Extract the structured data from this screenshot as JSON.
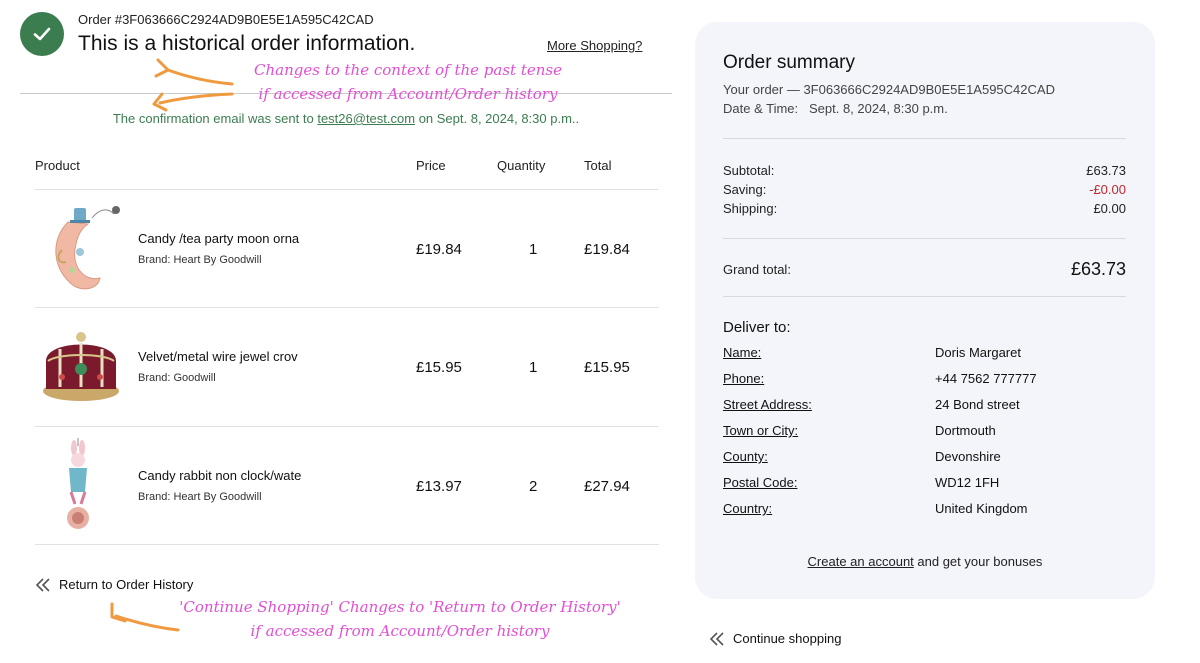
{
  "header": {
    "order_id_text": "Order #3F063666C2924AD9B0E5E1A595C42CAD",
    "title": "This is a historical order information.",
    "more_shopping": "More Shopping?",
    "confirmation_prefix": "The confirmation email was sent to ",
    "confirmation_email": "test26@test.com",
    "confirmation_suffix": " on Sept. 8, 2024, 8:30 p.m.."
  },
  "table": {
    "columns": [
      "Product",
      "Price",
      "Quantity",
      "Total"
    ],
    "rows": [
      {
        "name": "Candy /tea party moon orna",
        "brand_label": "Brand:",
        "brand": "Heart By Goodwill",
        "price": "£19.84",
        "quantity": "1",
        "total": "£19.84"
      },
      {
        "name": "Velvet/metal wire jewel crov",
        "brand_label": "Brand:",
        "brand": "Goodwill",
        "price": "£15.95",
        "quantity": "1",
        "total": "£15.95"
      },
      {
        "name": "Candy rabbit non clock/wate",
        "brand_label": "Brand:",
        "brand": "Heart By Goodwill",
        "price": "£13.97",
        "quantity": "2",
        "total": "£27.94"
      }
    ]
  },
  "return_link": "Return to Order History",
  "summary": {
    "title": "Order summary",
    "your_order": "Your order — 3F063666C2924AD9B0E5E1A595C42CAD",
    "date_time": "Date & Time:   Sept. 8, 2024, 8:30 p.m.",
    "subtotal_label": "Subtotal:",
    "subtotal_value": "£63.73",
    "saving_label": "Saving:",
    "saving_value": "-£0.00",
    "shipping_label": "Shipping:",
    "shipping_value": "£0.00",
    "grand_total_label": "Grand total:",
    "grand_total_value": "£63.73",
    "deliver_title": "Deliver to:",
    "deliver": [
      {
        "label": "Name:",
        "value": "Doris Margaret"
      },
      {
        "label": "Phone:",
        "value": "+44 7562 777777"
      },
      {
        "label": "Street Address:",
        "value": "24 Bond street"
      },
      {
        "label": "Town or City:",
        "value": "Dortmouth"
      },
      {
        "label": "County:",
        "value": "Devonshire"
      },
      {
        "label": "Postal Code:",
        "value": "WD12 1FH"
      },
      {
        "label": "Country:",
        "value": "United Kingdom"
      }
    ],
    "create_account_link": "Create an account",
    "create_account_suffix": " and get your bonuses"
  },
  "continue_link": "Continue shopping",
  "annotations": {
    "top_line1": "Changes to the context of the past tense",
    "top_line2": "if accessed from Account/Order history",
    "bottom_line1": "'Continue Shopping' Changes to 'Return to Order History'",
    "bottom_line2": "if accessed from Account/Order history"
  },
  "colors": {
    "accent_green": "#3b7d4f",
    "saving_red": "#c0282c",
    "annotation_pink": "#e24fd6",
    "annotation_arrow": "#ef9a3e",
    "summary_bg": "#f4f5fa"
  },
  "icons": [
    "check-icon",
    "double-chevron-left-icon"
  ]
}
